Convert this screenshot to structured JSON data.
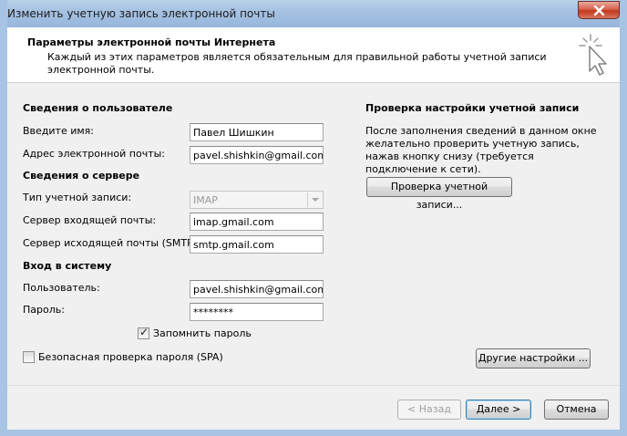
{
  "window": {
    "title": "Изменить учетную запись электронной почты"
  },
  "header": {
    "title": "Параметры электронной почты Интернета",
    "description": "Каждый из этих параметров является обязательным для правильной работы учетной записи электронной почты."
  },
  "user_info": {
    "heading": "Сведения о пользователе",
    "name_label": "Введите имя:",
    "name_value": "Павел Шишкин",
    "email_label": "Адрес электронной почты:",
    "email_value": "pavel.shishkin@gmail.com"
  },
  "server_info": {
    "heading": "Сведения о сервере",
    "account_type_label": "Тип учетной записи:",
    "account_type_value": "IMAP",
    "incoming_label": "Сервер входящей почты:",
    "incoming_value": "imap.gmail.com",
    "outgoing_label": "Сервер исходящей почты (SMTP):",
    "outgoing_value": "smtp.gmail.com"
  },
  "login": {
    "heading": "Вход в систему",
    "user_label": "Пользователь:",
    "user_value": "pavel.shishkin@gmail.com",
    "password_label": "Пароль:",
    "password_value": "********",
    "remember_label": "Запомнить пароль",
    "remember_checked": true,
    "spa_label": "Безопасная проверка пароля (SPA)",
    "spa_checked": false
  },
  "test": {
    "heading": "Проверка настройки учетной записи",
    "description": "После заполнения сведений в данном окне желательно проверить учетную запись, нажав кнопку снизу (требуется подключение к сети).",
    "button": "Проверка учетной записи..."
  },
  "buttons": {
    "more_settings": "Другие настройки ...",
    "back": "< Назад",
    "next": "Далее >",
    "cancel": "Отмена"
  },
  "icons": {
    "close": "close-icon",
    "wizard": "cursor-sparkle-icon",
    "dropdown": "chevron-down-icon",
    "check": "checkmark-icon"
  }
}
